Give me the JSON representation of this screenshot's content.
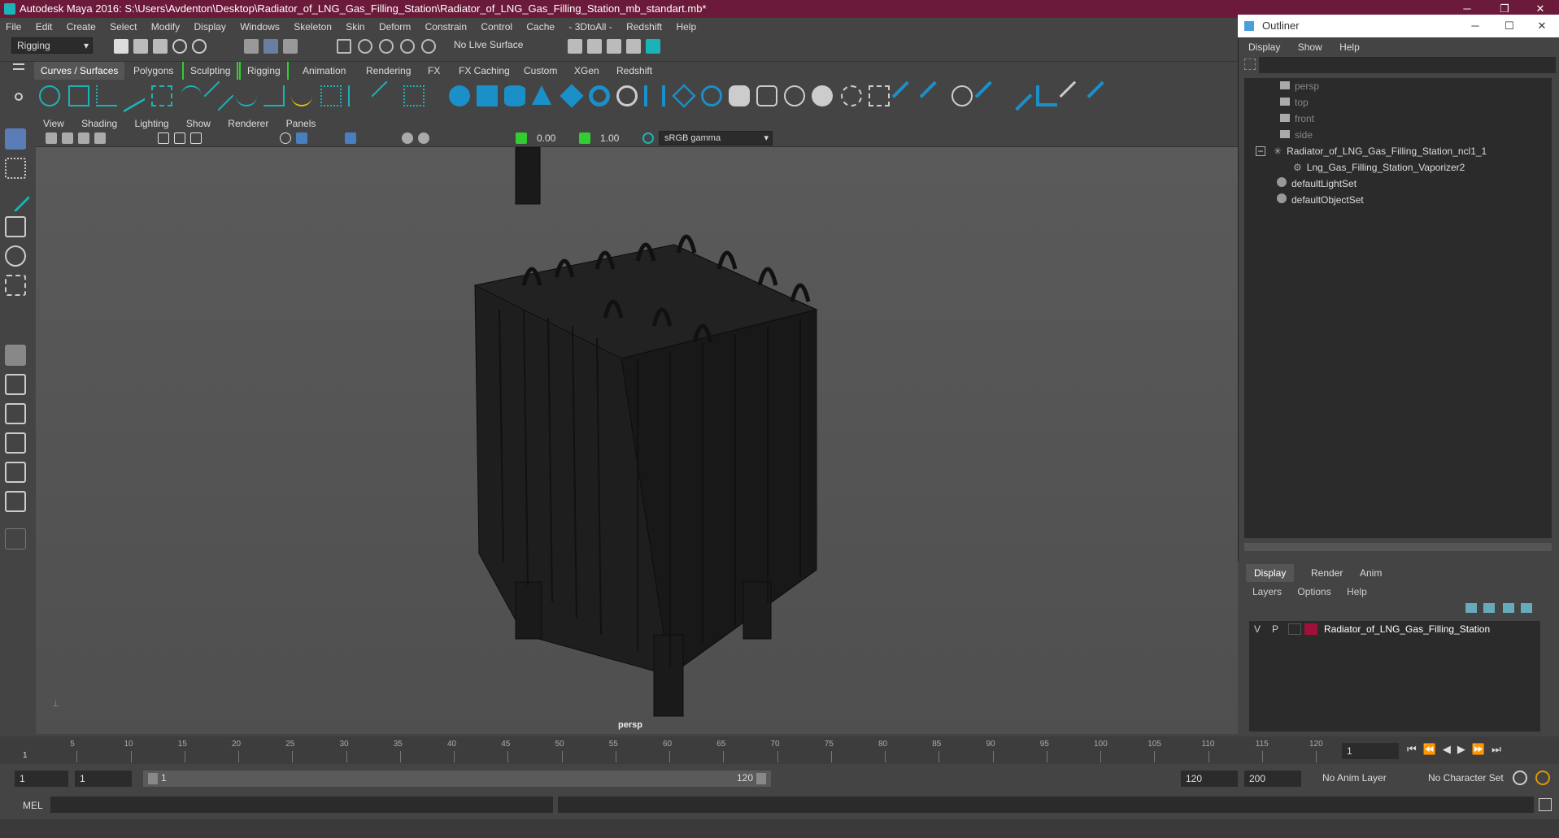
{
  "title": "Autodesk Maya 2016: S:\\Users\\Avdenton\\Desktop\\Radiator_of_LNG_Gas_Filling_Station\\Radiator_of_LNG_Gas_Filling_Station_mb_standart.mb*",
  "menu": [
    "File",
    "Edit",
    "Create",
    "Select",
    "Modify",
    "Display",
    "Windows",
    "Skeleton",
    "Skin",
    "Deform",
    "Constrain",
    "Control",
    "Cache",
    "- 3DtoAll -",
    "Redshift",
    "Help"
  ],
  "status": {
    "mode": "Rigging",
    "live_surface": "No Live Surface"
  },
  "shelf_tabs": [
    "Curves / Surfaces",
    "Polygons",
    "Sculpting",
    "Rigging",
    "Animation",
    "Rendering",
    "FX",
    "FX Caching",
    "Custom",
    "XGen",
    "Redshift"
  ],
  "panel_menu": [
    "View",
    "Shading",
    "Lighting",
    "Show",
    "Renderer",
    "Panels"
  ],
  "panel_tools": {
    "exposure": "0.00",
    "gamma": "1.00",
    "colorspace": "sRGB gamma"
  },
  "viewport_label": "persp",
  "outliner": {
    "title": "Outliner",
    "menu": [
      "Display",
      "Show",
      "Help"
    ],
    "items": [
      {
        "name": "persp",
        "dim": true
      },
      {
        "name": "top",
        "dim": true
      },
      {
        "name": "front",
        "dim": true
      },
      {
        "name": "side",
        "dim": true
      },
      {
        "name": "Radiator_of_LNG_Gas_Filling_Station_ncl1_1",
        "dim": false
      },
      {
        "name": "Lng_Gas_Filling_Station_Vaporizer2",
        "dim": false
      },
      {
        "name": "defaultLightSet",
        "dim": false
      },
      {
        "name": "defaultObjectSet",
        "dim": false
      }
    ]
  },
  "layers": {
    "tabs": [
      "Display",
      "Render",
      "Anim"
    ],
    "menu": [
      "Layers",
      "Options",
      "Help"
    ],
    "row": {
      "v": "V",
      "p": "P",
      "name": "Radiator_of_LNG_Gas_Filling_Station",
      "color": "#a0103a"
    }
  },
  "timeline": {
    "ticks": [
      "5",
      "10",
      "15",
      "20",
      "25",
      "30",
      "35",
      "40",
      "45",
      "50",
      "55",
      "60",
      "65",
      "70",
      "75",
      "80",
      "85",
      "90",
      "95",
      "100",
      "105",
      "110",
      "115",
      "120"
    ],
    "start_marker": "1",
    "current_frame": "1"
  },
  "range": {
    "start": "1",
    "anim_start": "1",
    "inner_start": "1",
    "inner_end": "120",
    "end": "120",
    "anim_end": "200",
    "anim_layer": "No Anim Layer",
    "char_set": "No Character Set"
  },
  "cmd": {
    "label": "MEL"
  },
  "colors": {
    "accent": "#1bb3b8",
    "title_bg": "#6b1a3a"
  }
}
